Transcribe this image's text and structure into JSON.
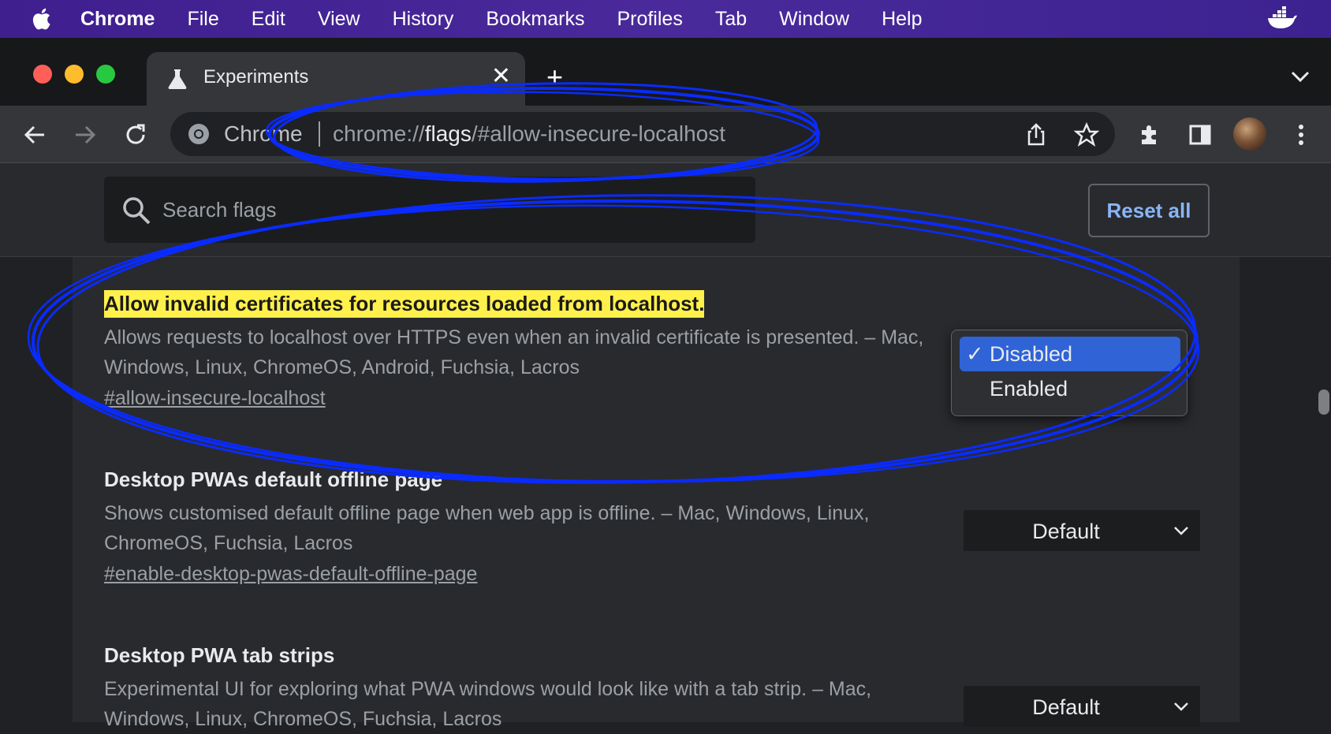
{
  "menubar": {
    "app": "Chrome",
    "items": [
      "File",
      "Edit",
      "View",
      "History",
      "Bookmarks",
      "Profiles",
      "Tab",
      "Window",
      "Help"
    ]
  },
  "tab": {
    "title": "Experiments",
    "close": "✕"
  },
  "newtab": "+",
  "omnibox": {
    "origin": "Chrome",
    "url_prefix": "chrome://",
    "url_host": "flags",
    "url_rest": "/#allow-insecure-localhost"
  },
  "search": {
    "placeholder": "Search flags"
  },
  "reset_label": "Reset all",
  "flags": [
    {
      "name": "Allow invalid certificates for resources loaded from localhost.",
      "description": "Allows requests to localhost over HTTPS even when an invalid certificate is presented. – Mac, Windows, Linux, ChromeOS, Android, Fuchsia, Lacros",
      "link": "#allow-insecure-localhost",
      "highlighted": true
    },
    {
      "name": "Desktop PWAs default offline page",
      "description": "Shows customised default offline page when web app is offline. – Mac, Windows, Linux, ChromeOS, Fuchsia, Lacros",
      "link": "#enable-desktop-pwas-default-offline-page",
      "select_value": "Default"
    },
    {
      "name": "Desktop PWA tab strips",
      "description": "Experimental UI for exploring what PWA windows would look like with a tab strip. – Mac, Windows, Linux, ChromeOS, Fuchsia, Lacros",
      "select_value": "Default"
    }
  ],
  "dropdown": {
    "options": [
      {
        "label": "Disabled",
        "selected": true,
        "check": "✓"
      },
      {
        "label": "Enabled",
        "selected": false
      }
    ]
  },
  "colors": {
    "menubar": "#4a2a9b",
    "highlight": "#fff04c",
    "accent": "#8ab4f8",
    "selected_option": "#2f63d6",
    "annotation": "#0a2bff"
  },
  "icons": [
    "apple-icon",
    "docker-icon",
    "flask-icon",
    "back-icon",
    "forward-icon",
    "reload-icon",
    "chrome-logo-icon",
    "share-icon",
    "star-icon",
    "extensions-icon",
    "side-panel-icon",
    "menu-icon",
    "search-icon",
    "chevron-down-icon"
  ]
}
